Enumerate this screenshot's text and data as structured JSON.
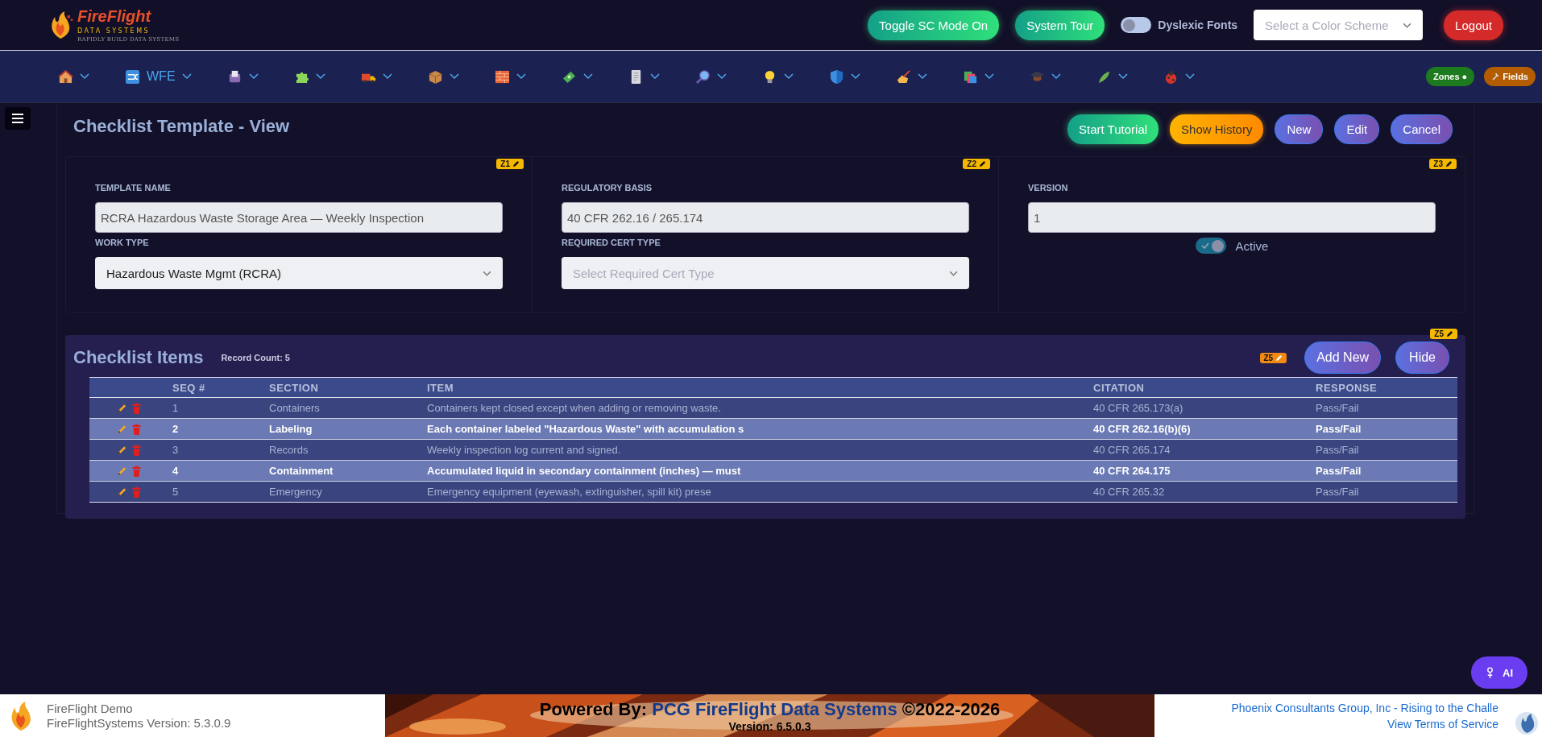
{
  "header": {
    "logo": {
      "name": "FireFlight",
      "line_1": "DATA SYSTEMS",
      "line_2": "RAPIDLY BUILD DATA SYSTEMS"
    },
    "buttons": [
      {
        "label": "Toggle SC Mode On",
        "kind": "green"
      },
      {
        "label": "System Tour",
        "kind": "green"
      }
    ],
    "dyslexic_toggle": {
      "label": "Dyslexic Fonts",
      "on": false
    },
    "color_scheme": {
      "placeholder": "Select a Color Scheme"
    },
    "logout": {
      "label": "Logout"
    }
  },
  "nav": {
    "menus": [
      {
        "expanded": false
      },
      {
        "label": "WFE",
        "expanded": false
      },
      {
        "expanded": false
      },
      {
        "expanded": false
      },
      {
        "expanded": false
      },
      {
        "expanded": false
      },
      {
        "expanded": false
      },
      {
        "expanded": false
      },
      {
        "expanded": false
      },
      {
        "expanded": false
      },
      {
        "expanded": false
      },
      {
        "expanded": false
      },
      {
        "expanded": false
      },
      {
        "expanded": false
      },
      {
        "expanded": false
      },
      {
        "expanded": false
      },
      {
        "expanded": false
      }
    ],
    "badges": [
      {
        "label": "Zones ●",
        "color": "#1e7a1e"
      },
      {
        "label": "Fields",
        "color": "#b35c00"
      }
    ]
  },
  "page": {
    "title": "Checklist Template - View",
    "actions": [
      {
        "label": "Start Tutorial",
        "kind": "green"
      },
      {
        "label": "Show History",
        "kind": "orange"
      },
      {
        "label": "New",
        "kind": "purple"
      },
      {
        "label": "Edit",
        "kind": "purple"
      },
      {
        "label": "Cancel",
        "kind": "purple"
      }
    ]
  },
  "form": {
    "zones": [
      {
        "zone": "Z1",
        "fields": [
          {
            "label": "TEMPLATE NAME",
            "kind": "input",
            "value": "RCRA Hazardous Waste Storage Area — Weekly Inspection"
          },
          {
            "label": "WORK TYPE",
            "kind": "select",
            "value": "Hazardous Waste Mgmt (RCRA)"
          }
        ]
      },
      {
        "zone": "Z2",
        "fields": [
          {
            "label": "REGULATORY BASIS",
            "kind": "input",
            "value": "40 CFR 262.16 / 265.174"
          },
          {
            "label": "REQUIRED CERT TYPE",
            "kind": "select",
            "placeholder": "Select Required Cert Type"
          }
        ]
      },
      {
        "zone": "Z3",
        "fields": [
          {
            "label": "VERSION",
            "kind": "input",
            "value": "1"
          }
        ],
        "active": {
          "label": "Active",
          "on": true
        }
      }
    ]
  },
  "checklist": {
    "title": "Checklist Items",
    "record_count": "Record Count: 5",
    "zone_top": "Z5",
    "zone_inline": "Z5",
    "buttons": [
      {
        "label": "Add New"
      },
      {
        "label": "Hide"
      }
    ],
    "table": {
      "columns": [
        "SEQ #",
        "SECTION",
        "ITEM",
        "CITATION",
        "RESPONSE"
      ],
      "rows": [
        {
          "selected": false,
          "cells": [
            "1",
            "Containers",
            "Containers kept closed except when adding or removing waste.",
            "40 CFR 265.173(a)",
            "Pass/Fail"
          ]
        },
        {
          "selected": true,
          "cells": [
            "2",
            "Labeling",
            "Each container labeled \"Hazardous Waste\" with accumulation s",
            "40 CFR 262.16(b)(6)",
            "Pass/Fail"
          ]
        },
        {
          "selected": false,
          "cells": [
            "3",
            "Records",
            "Weekly inspection log current and signed.",
            "40 CFR 265.174",
            "Pass/Fail"
          ]
        },
        {
          "selected": true,
          "cells": [
            "4",
            "Containment",
            "Accumulated liquid in secondary containment (inches) — must",
            "40 CFR 264.175",
            "Pass/Fail"
          ]
        },
        {
          "selected": false,
          "cells": [
            "5",
            "Emergency",
            "Emergency equipment (eyewash, extinguisher, spill kit) prese",
            "40 CFR 265.32",
            "Pass/Fail"
          ]
        }
      ]
    }
  },
  "footer": {
    "app_name": "FireFlight Demo",
    "app_version": "FireFlightSystems Version: 5.3.0.9",
    "powered_prefix": "Powered By:",
    "powered_name": "PCG FireFlight Data Systems",
    "powered_suffix": "©2022-2026",
    "version": "Version: 6.5.0.3",
    "company": "Phoenix Consultants Group, Inc - Rising to the Challe",
    "terms": "View Terms of Service"
  },
  "ai_button": {
    "label": "AI"
  }
}
